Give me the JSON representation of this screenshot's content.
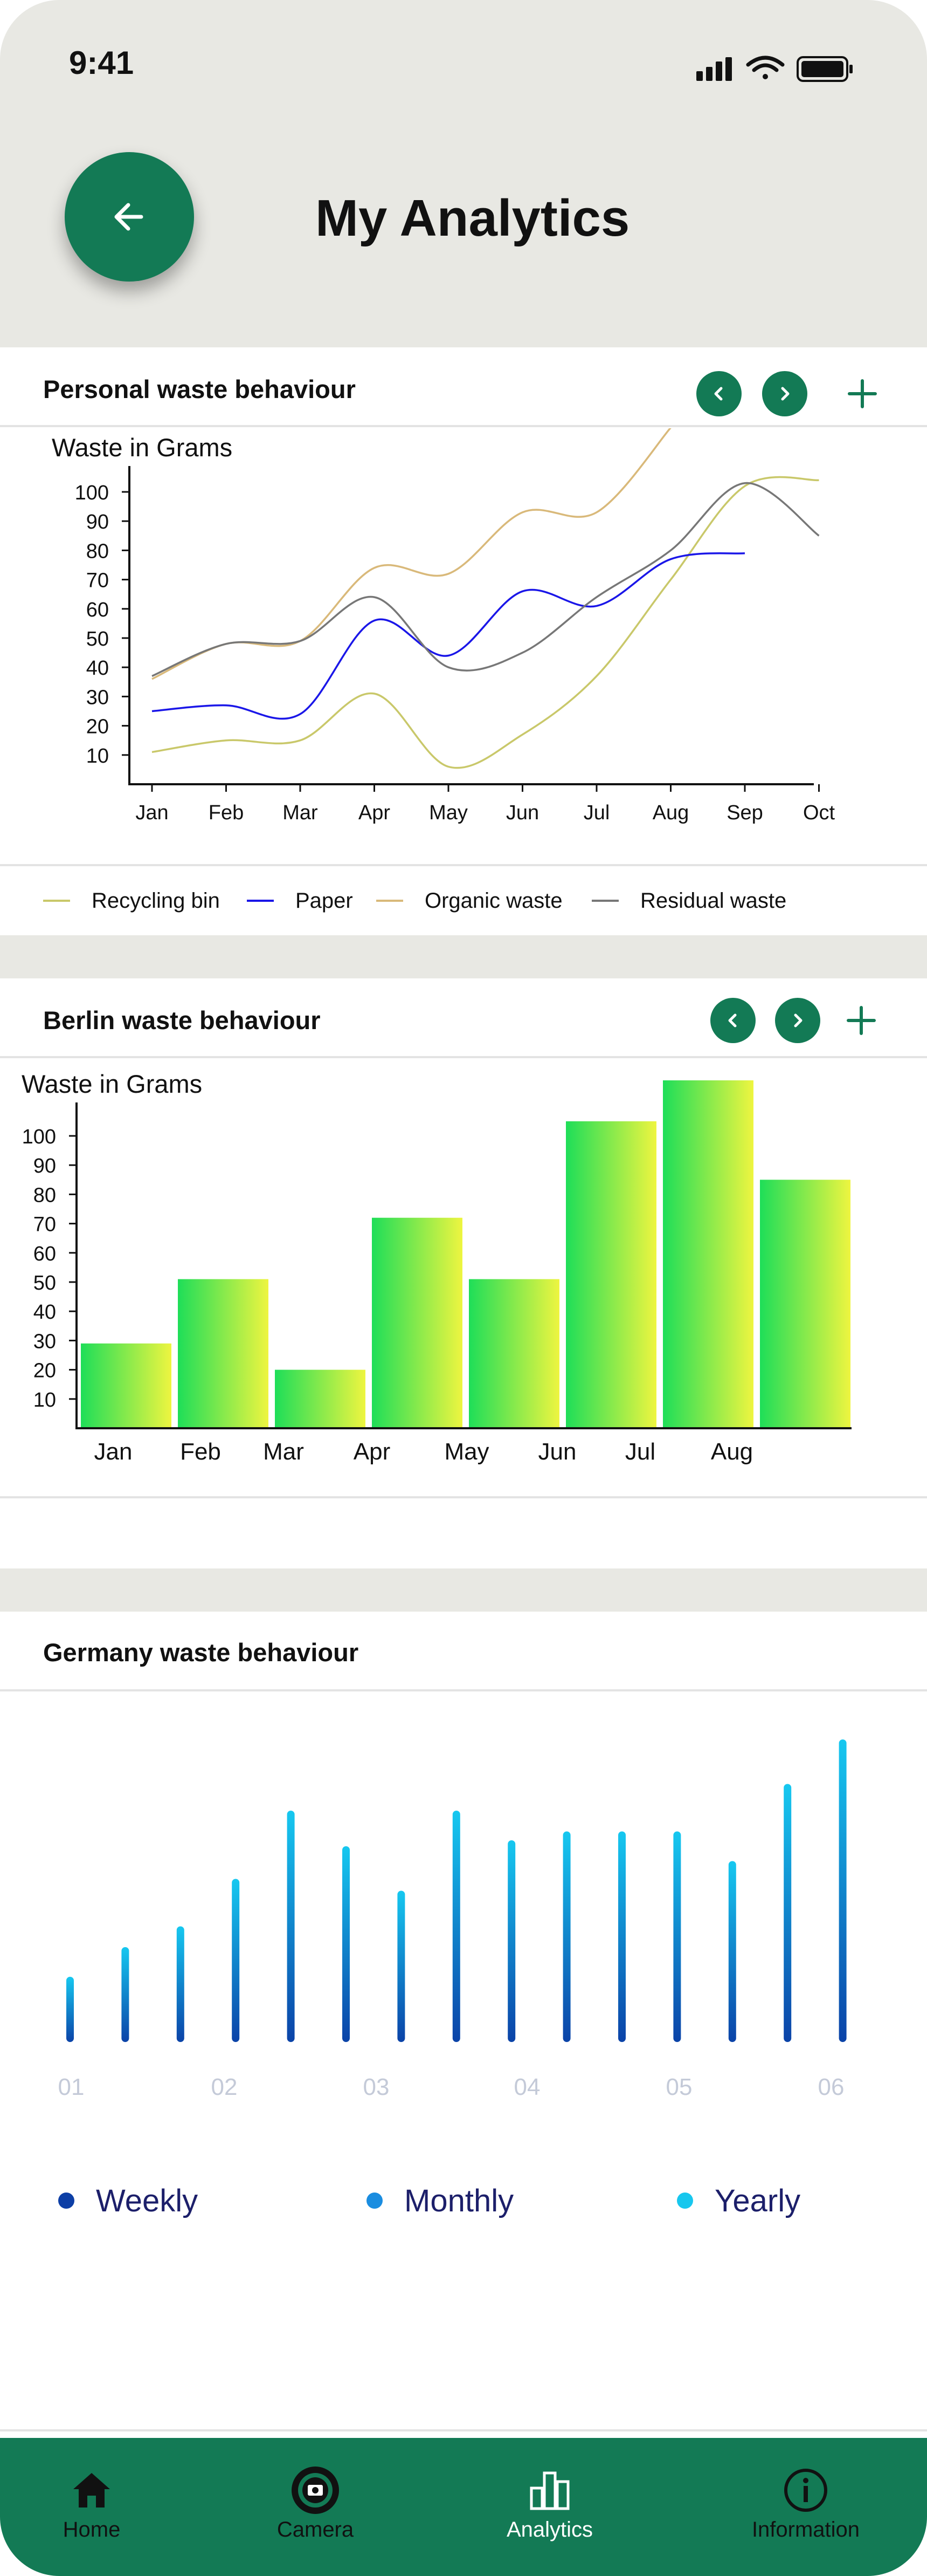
{
  "status": {
    "time": "9:41"
  },
  "header": {
    "title": "My Analytics"
  },
  "personal": {
    "title": "Personal waste behaviour",
    "y_label": "Waste in Grams",
    "legend": [
      {
        "label": "Recycling bin",
        "color": "#c9c86a"
      },
      {
        "label": "Paper",
        "color": "#1a16e8"
      },
      {
        "label": "Organic waste",
        "color": "#d9b97a"
      },
      {
        "label": "Residual waste",
        "color": "#777777"
      }
    ]
  },
  "berlin": {
    "title": "Berlin waste behaviour",
    "y_label": "Waste in Grams"
  },
  "germany": {
    "title": "Germany  waste behaviour",
    "legend": [
      {
        "label": "Weekly",
        "color": "#0d3fa6"
      },
      {
        "label": "Monthly",
        "color": "#1a8de0"
      },
      {
        "label": "Yearly",
        "color": "#17c7ee"
      }
    ]
  },
  "nav": [
    {
      "label": "Home",
      "icon": "home-icon"
    },
    {
      "label": "Camera",
      "icon": "camera-icon"
    },
    {
      "label": "Analytics",
      "icon": "analytics-icon"
    },
    {
      "label": "Information",
      "icon": "info-icon"
    }
  ],
  "chart_data": [
    {
      "type": "line",
      "title": "Personal waste behaviour",
      "ylabel": "Waste in Grams",
      "categories": [
        "Jan",
        "Feb",
        "Mar",
        "Apr",
        "May",
        "Jun",
        "Jul",
        "Aug",
        "Sep",
        "Oct"
      ],
      "yticks": [
        10,
        20,
        30,
        40,
        50,
        60,
        70,
        80,
        90,
        100
      ],
      "ylim": [
        0,
        110
      ],
      "series": [
        {
          "name": "Recycling bin",
          "color": "#c9c86a",
          "values": [
            11,
            15,
            15,
            31,
            6,
            17,
            37,
            70,
            102,
            104
          ]
        },
        {
          "name": "Paper",
          "color": "#1a16e8",
          "values": [
            25,
            27,
            24,
            56,
            44,
            66,
            61,
            77,
            79,
            null
          ]
        },
        {
          "name": "Organic waste",
          "color": "#d9b97a",
          "values": [
            36,
            48,
            49,
            74,
            72,
            93,
            93,
            122,
            null,
            null
          ]
        },
        {
          "name": "Residual waste",
          "color": "#777777",
          "values": [
            37,
            48,
            49,
            64,
            40,
            45,
            64,
            80,
            103,
            85
          ]
        }
      ],
      "grid": false
    },
    {
      "type": "bar",
      "title": "Berlin waste behaviour",
      "ylabel": "Waste in Grams",
      "categories": [
        "Jan",
        "Feb",
        "Mar",
        "Apr",
        "May",
        "Jun",
        "Jul",
        "Aug",
        "",
        ""
      ],
      "yticks": [
        10,
        20,
        30,
        40,
        50,
        60,
        70,
        80,
        90,
        100
      ],
      "ylim": [
        0,
        110
      ],
      "values": [
        29,
        51,
        20,
        72,
        51,
        105,
        119,
        85
      ],
      "grid": false
    },
    {
      "type": "bar",
      "title": "Germany  waste behaviour",
      "categories": [
        "01",
        "02",
        "03",
        "04",
        "05",
        "06"
      ],
      "values": [
        22,
        32,
        39,
        55,
        78,
        66,
        51,
        78,
        68,
        71,
        71,
        71,
        61,
        87,
        102
      ],
      "ylim": [
        0,
        110
      ],
      "legend": [
        "Weekly",
        "Monthly",
        "Yearly"
      ],
      "grid": false
    }
  ]
}
